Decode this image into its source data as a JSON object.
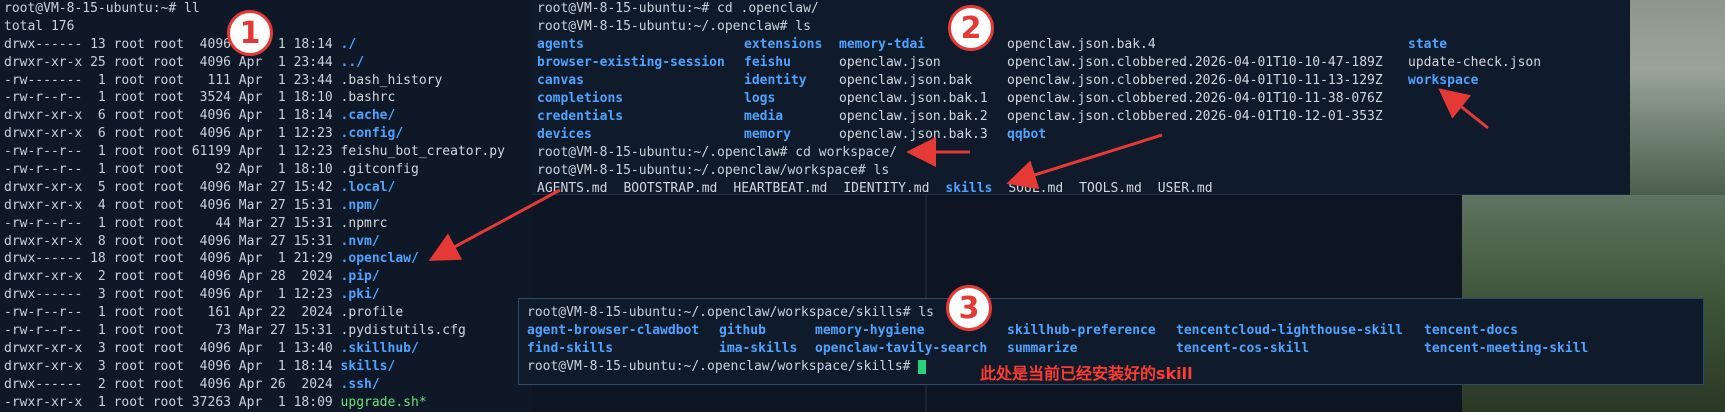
{
  "terminal_1": {
    "command": "root@VM-8-15-ubuntu:~# ll",
    "total": "total 176",
    "rows": [
      {
        "perm": "drwx------ 13 root root  4096 Apr  1 18:14 ",
        "name": "./",
        "kind": "dir"
      },
      {
        "perm": "drwxr-xr-x 25 root root  4096 Apr  1 23:44 ",
        "name": "../",
        "kind": "dir"
      },
      {
        "perm": "-rw-------  1 root root   111 Apr  1 23:44 ",
        "name": ".bash_history",
        "kind": "file"
      },
      {
        "perm": "-rw-r--r--  1 root root  3524 Apr  1 18:10 ",
        "name": ".bashrc",
        "kind": "file"
      },
      {
        "perm": "drwxr-xr-x  6 root root  4096 Apr  1 18:14 ",
        "name": ".cache/",
        "kind": "dir"
      },
      {
        "perm": "drwxr-xr-x  6 root root  4096 Apr  1 12:23 ",
        "name": ".config/",
        "kind": "dir"
      },
      {
        "perm": "-rw-r--r--  1 root root 61199 Apr  1 12:23 ",
        "name": "feishu_bot_creator.py",
        "kind": "file"
      },
      {
        "perm": "-rw-r--r--  1 root root    92 Apr  1 18:10 ",
        "name": ".gitconfig",
        "kind": "file"
      },
      {
        "perm": "drwxr-xr-x  5 root root  4096 Mar 27 15:42 ",
        "name": ".local/",
        "kind": "dir"
      },
      {
        "perm": "drwxr-xr-x  4 root root  4096 Mar 27 15:31 ",
        "name": ".npm/",
        "kind": "dir"
      },
      {
        "perm": "-rw-r--r--  1 root root    44 Mar 27 15:31 ",
        "name": ".npmrc",
        "kind": "file"
      },
      {
        "perm": "drwxr-xr-x  8 root root  4096 Mar 27 15:31 ",
        "name": ".nvm/",
        "kind": "dir"
      },
      {
        "perm": "drwx------ 18 root root  4096 Apr  1 21:29 ",
        "name": ".openclaw/",
        "kind": "dir"
      },
      {
        "perm": "drwxr-xr-x  2 root root  4096 Apr 28  2024 ",
        "name": ".pip/",
        "kind": "dir"
      },
      {
        "perm": "drwx------  3 root root  4096 Apr  1 12:23 ",
        "name": ".pki/",
        "kind": "dir"
      },
      {
        "perm": "-rw-r--r--  1 root root   161 Apr 22  2024 ",
        "name": ".profile",
        "kind": "file"
      },
      {
        "perm": "-rw-r--r--  1 root root    73 Mar 27 15:31 ",
        "name": ".pydistutils.cfg",
        "kind": "file"
      },
      {
        "perm": "drwxr-xr-x  3 root root  4096 Apr  1 13:40 ",
        "name": ".skillhub/",
        "kind": "dir"
      },
      {
        "perm": "drwxr-xr-x  3 root root  4096 Apr  1 18:14 ",
        "name": "skills/",
        "kind": "dir"
      },
      {
        "perm": "drwx------  2 root root  4096 Apr 26  2024 ",
        "name": ".ssh/",
        "kind": "dir"
      },
      {
        "perm": "-rwxr-xr-x  1 root root 37263 Apr  1 18:09 ",
        "name": "upgrade.sh*",
        "kind": "exe"
      }
    ]
  },
  "terminal_2": {
    "cmd1": "root@VM-8-15-ubuntu:~# cd .openclaw/",
    "cmd2": "root@VM-8-15-ubuntu:~/.openclaw# ls",
    "grid": [
      [
        {
          "t": "agents",
          "k": "dir"
        },
        {
          "t": "extensions",
          "k": "dir"
        },
        {
          "t": "memory-tdai",
          "k": "dir"
        },
        {
          "t": "openclaw.json.bak.4",
          "k": "file"
        },
        {
          "t": "state",
          "k": "dir"
        }
      ],
      [
        {
          "t": "browser-existing-session",
          "k": "dir"
        },
        {
          "t": "feishu",
          "k": "dir"
        },
        {
          "t": "openclaw.json",
          "k": "file"
        },
        {
          "t": "openclaw.json.clobbered.2026-04-01T10-10-47-189Z",
          "k": "file"
        },
        {
          "t": "update-check.json",
          "k": "file"
        }
      ],
      [
        {
          "t": "canvas",
          "k": "dir"
        },
        {
          "t": "identity",
          "k": "dir"
        },
        {
          "t": "openclaw.json.bak",
          "k": "plain"
        },
        {
          "t": "openclaw.json.clobbered.2026-04-01T10-11-13-129Z",
          "k": "file"
        },
        {
          "t": "workspace",
          "k": "dir"
        }
      ],
      [
        {
          "t": "completions",
          "k": "dir"
        },
        {
          "t": "logs",
          "k": "dir"
        },
        {
          "t": "openclaw.json.bak.1",
          "k": "file"
        },
        {
          "t": "openclaw.json.clobbered.2026-04-01T10-11-38-076Z",
          "k": "file"
        },
        {
          "t": "",
          "k": "file"
        }
      ],
      [
        {
          "t": "credentials",
          "k": "dir"
        },
        {
          "t": "media",
          "k": "dir"
        },
        {
          "t": "openclaw.json.bak.2",
          "k": "file"
        },
        {
          "t": "openclaw.json.clobbered.2026-04-01T10-12-01-353Z",
          "k": "file"
        },
        {
          "t": "",
          "k": "file"
        }
      ],
      [
        {
          "t": "devices",
          "k": "dir"
        },
        {
          "t": "memory",
          "k": "dir"
        },
        {
          "t": "openclaw.json.bak.3",
          "k": "file"
        },
        {
          "t": "qqbot",
          "k": "dir"
        },
        {
          "t": "",
          "k": "file"
        }
      ]
    ],
    "cmd3": "root@VM-8-15-ubuntu:~/.openclaw# cd workspace/",
    "cmd4": "root@VM-8-15-ubuntu:~/.openclaw/workspace# ls",
    "workspace_items": [
      {
        "t": "AGENTS.md",
        "k": "file"
      },
      {
        "t": "BOOTSTRAP.md",
        "k": "file"
      },
      {
        "t": "HEARTBEAT.md",
        "k": "file"
      },
      {
        "t": "IDENTITY.md",
        "k": "file"
      },
      {
        "t": "skills",
        "k": "dir"
      },
      {
        "t": "SOUL.md",
        "k": "file"
      },
      {
        "t": "TOOLS.md",
        "k": "file"
      },
      {
        "t": "USER.md",
        "k": "file"
      }
    ]
  },
  "terminal_3": {
    "cmd1": "root@VM-8-15-ubuntu:~/.openclaw/workspace/skills# ls",
    "grid": [
      [
        "agent-browser-clawdbot",
        "github",
        "memory-hygiene",
        "skillhub-preference",
        "tencentcloud-lighthouse-skill",
        "tencent-docs"
      ],
      [
        "find-skills",
        "ima-skills",
        "openclaw-tavily-search",
        "summarize",
        "tencent-cos-skill",
        "tencent-meeting-skill"
      ]
    ],
    "prompt": "root@VM-8-15-ubuntu:~/.openclaw/workspace/skills#"
  },
  "annotations": {
    "badge1": "1",
    "badge2": "2",
    "badge3": "3",
    "note": "此处是当前已经安装好的skill",
    "color": "#e53935"
  },
  "colors": {
    "dir": "#4fa3ff",
    "exe": "#6ee07a",
    "text": "#c9d2da",
    "cursor": "#26d07c"
  }
}
